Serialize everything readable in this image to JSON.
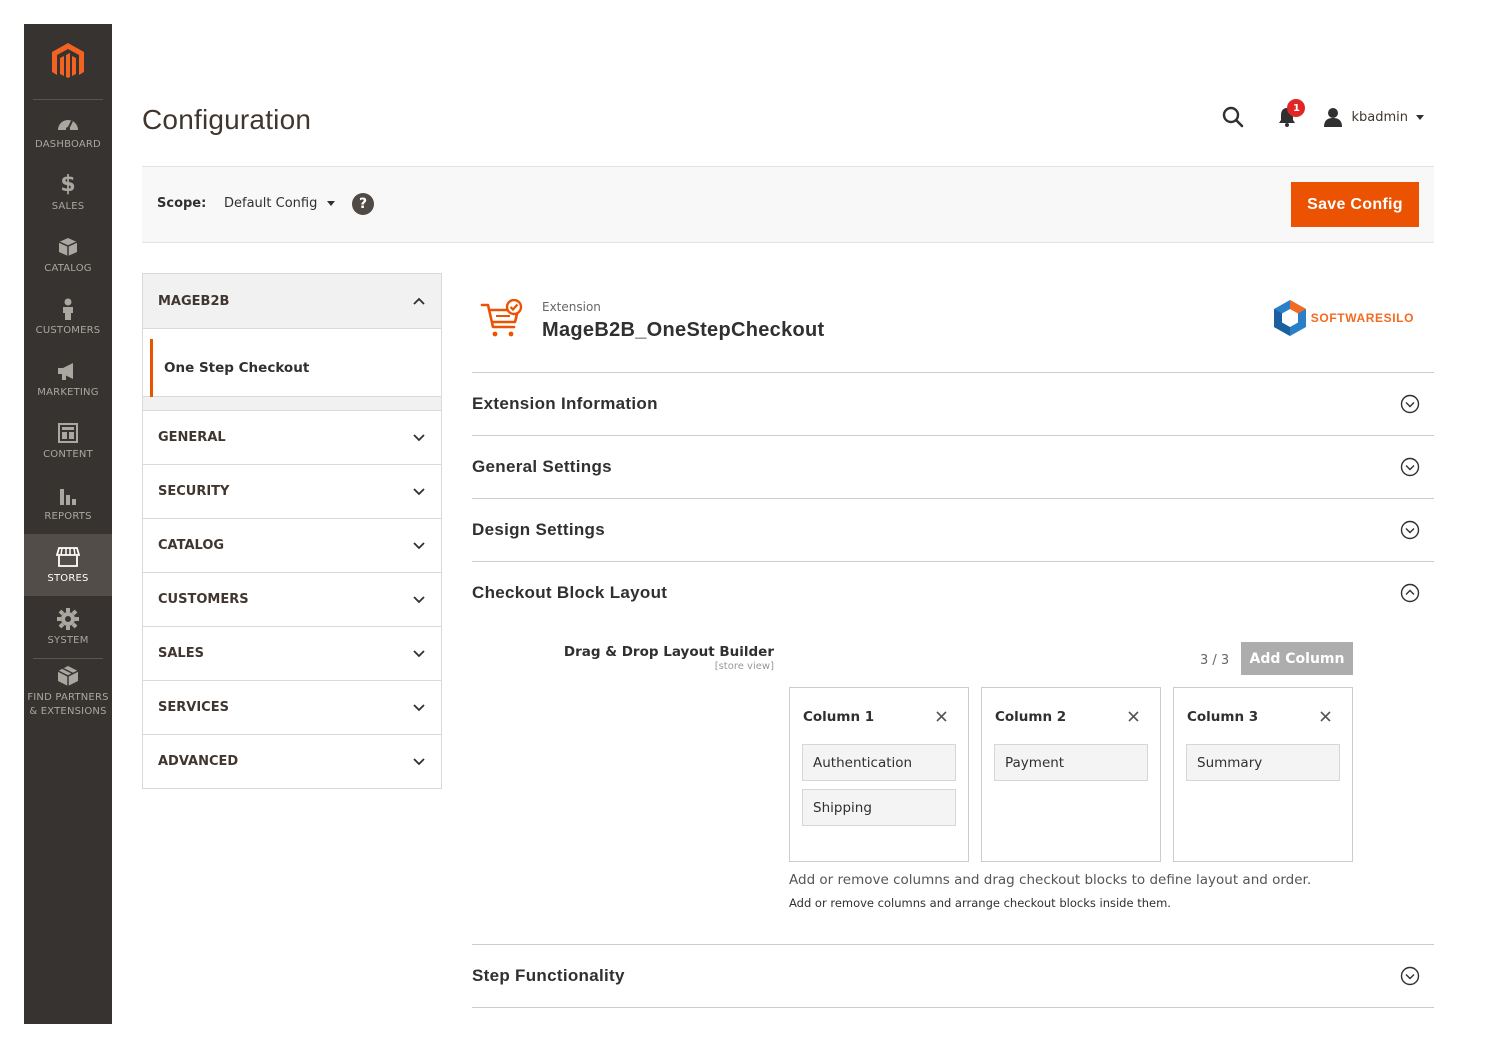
{
  "nav": {
    "items": [
      {
        "label": "DASHBOARD",
        "icon": "dashboard-icon"
      },
      {
        "label": "SALES",
        "icon": "dollar-icon"
      },
      {
        "label": "CATALOG",
        "icon": "box-icon"
      },
      {
        "label": "CUSTOMERS",
        "icon": "person-icon"
      },
      {
        "label": "MARKETING",
        "icon": "megaphone-icon"
      },
      {
        "label": "CONTENT",
        "icon": "layout-icon"
      },
      {
        "label": "REPORTS",
        "icon": "bar-chart-icon"
      },
      {
        "label": "STORES",
        "icon": "store-icon"
      },
      {
        "label": "SYSTEM",
        "icon": "gear-icon"
      },
      {
        "label": "FIND PARTNERS & EXTENSIONS",
        "icon": "blocks-icon"
      }
    ],
    "active": "STORES",
    "accent": "#eb5202"
  },
  "header": {
    "title": "Configuration",
    "notifications_count": "1",
    "username": "kbadmin"
  },
  "scope": {
    "label": "Scope:",
    "value": "Default Config",
    "help": "?",
    "save_label": "Save Config"
  },
  "tabs": {
    "group_title": "MAGEB2B",
    "group_item": "One Step Checkout",
    "sections": [
      "GENERAL",
      "SECURITY",
      "CATALOG",
      "CUSTOMERS",
      "SALES",
      "SERVICES",
      "ADVANCED"
    ]
  },
  "extension": {
    "small_label": "Extension",
    "name": "MageB2B_OneStepCheckout",
    "brand": "SOFTWARESILO"
  },
  "sections": [
    {
      "title": "Extension Information",
      "expanded": false
    },
    {
      "title": "General Settings",
      "expanded": false
    },
    {
      "title": "Design Settings",
      "expanded": false
    },
    {
      "title": "Checkout Block Layout",
      "expanded": true
    },
    {
      "title": "Step Functionality",
      "expanded": false
    }
  ],
  "builder": {
    "label": "Drag & Drop Layout Builder",
    "scope": "[store view]",
    "count": "3 / 3",
    "add_label": "Add Column",
    "columns": [
      {
        "title": "Column 1",
        "blocks": [
          "Authentication",
          "Shipping"
        ]
      },
      {
        "title": "Column 2",
        "blocks": [
          "Payment"
        ]
      },
      {
        "title": "Column 3",
        "blocks": [
          "Summary"
        ]
      }
    ],
    "note": "Add or remove columns and drag checkout blocks to define layout and order.",
    "comment": "Add or remove columns and arrange checkout blocks inside them."
  }
}
